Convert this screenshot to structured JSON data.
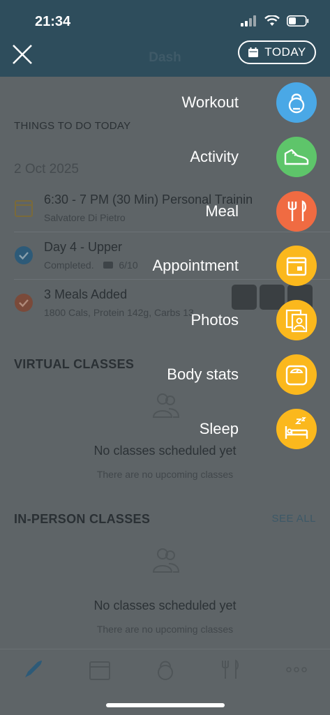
{
  "status_bar": {
    "time": "21:34"
  },
  "header": {
    "title": "Dash",
    "today_label": "TODAY"
  },
  "things_todo": {
    "label": "THINGS TO DO TODAY",
    "date": "2 Oct 2025",
    "tasks": [
      {
        "title": "6:30 - 7 PM (30 Min) Personal Trainin",
        "subtitle": "Salvatore Di Pietro"
      },
      {
        "title": "Day 4 - Upper",
        "subtitle": "Completed.",
        "count": "6/10"
      },
      {
        "title": "3 Meals Added",
        "subtitle": "1800 Cals, Protein 142g, Carbs 13"
      }
    ]
  },
  "virtual_classes": {
    "title": "VIRTUAL CLASSES",
    "empty_title": "No classes scheduled yet",
    "empty_sub": "There are no upcoming classes"
  },
  "in_person_classes": {
    "title": "IN-PERSON CLASSES",
    "see_all": "SEE ALL",
    "empty_title": "No classes scheduled yet",
    "empty_sub": "There are no upcoming classes"
  },
  "fab_menu": [
    {
      "label": "Workout",
      "color": "#4aa8e6",
      "icon": "kettlebell-icon"
    },
    {
      "label": "Activity",
      "color": "#5ec56a",
      "icon": "sneaker-icon"
    },
    {
      "label": "Meal",
      "color": "#f06b42",
      "icon": "fork-knife-icon"
    },
    {
      "label": "Appointment",
      "color": "#fbb81d",
      "icon": "calendar-icon"
    },
    {
      "label": "Photos",
      "color": "#fbb81d",
      "icon": "photos-icon"
    },
    {
      "label": "Body stats",
      "color": "#fbb81d",
      "icon": "scale-icon"
    },
    {
      "label": "Sleep",
      "color": "#fbb81d",
      "icon": "sleep-icon"
    }
  ],
  "tabs": [
    "home",
    "calendar",
    "workouts",
    "nutrition",
    "more"
  ]
}
